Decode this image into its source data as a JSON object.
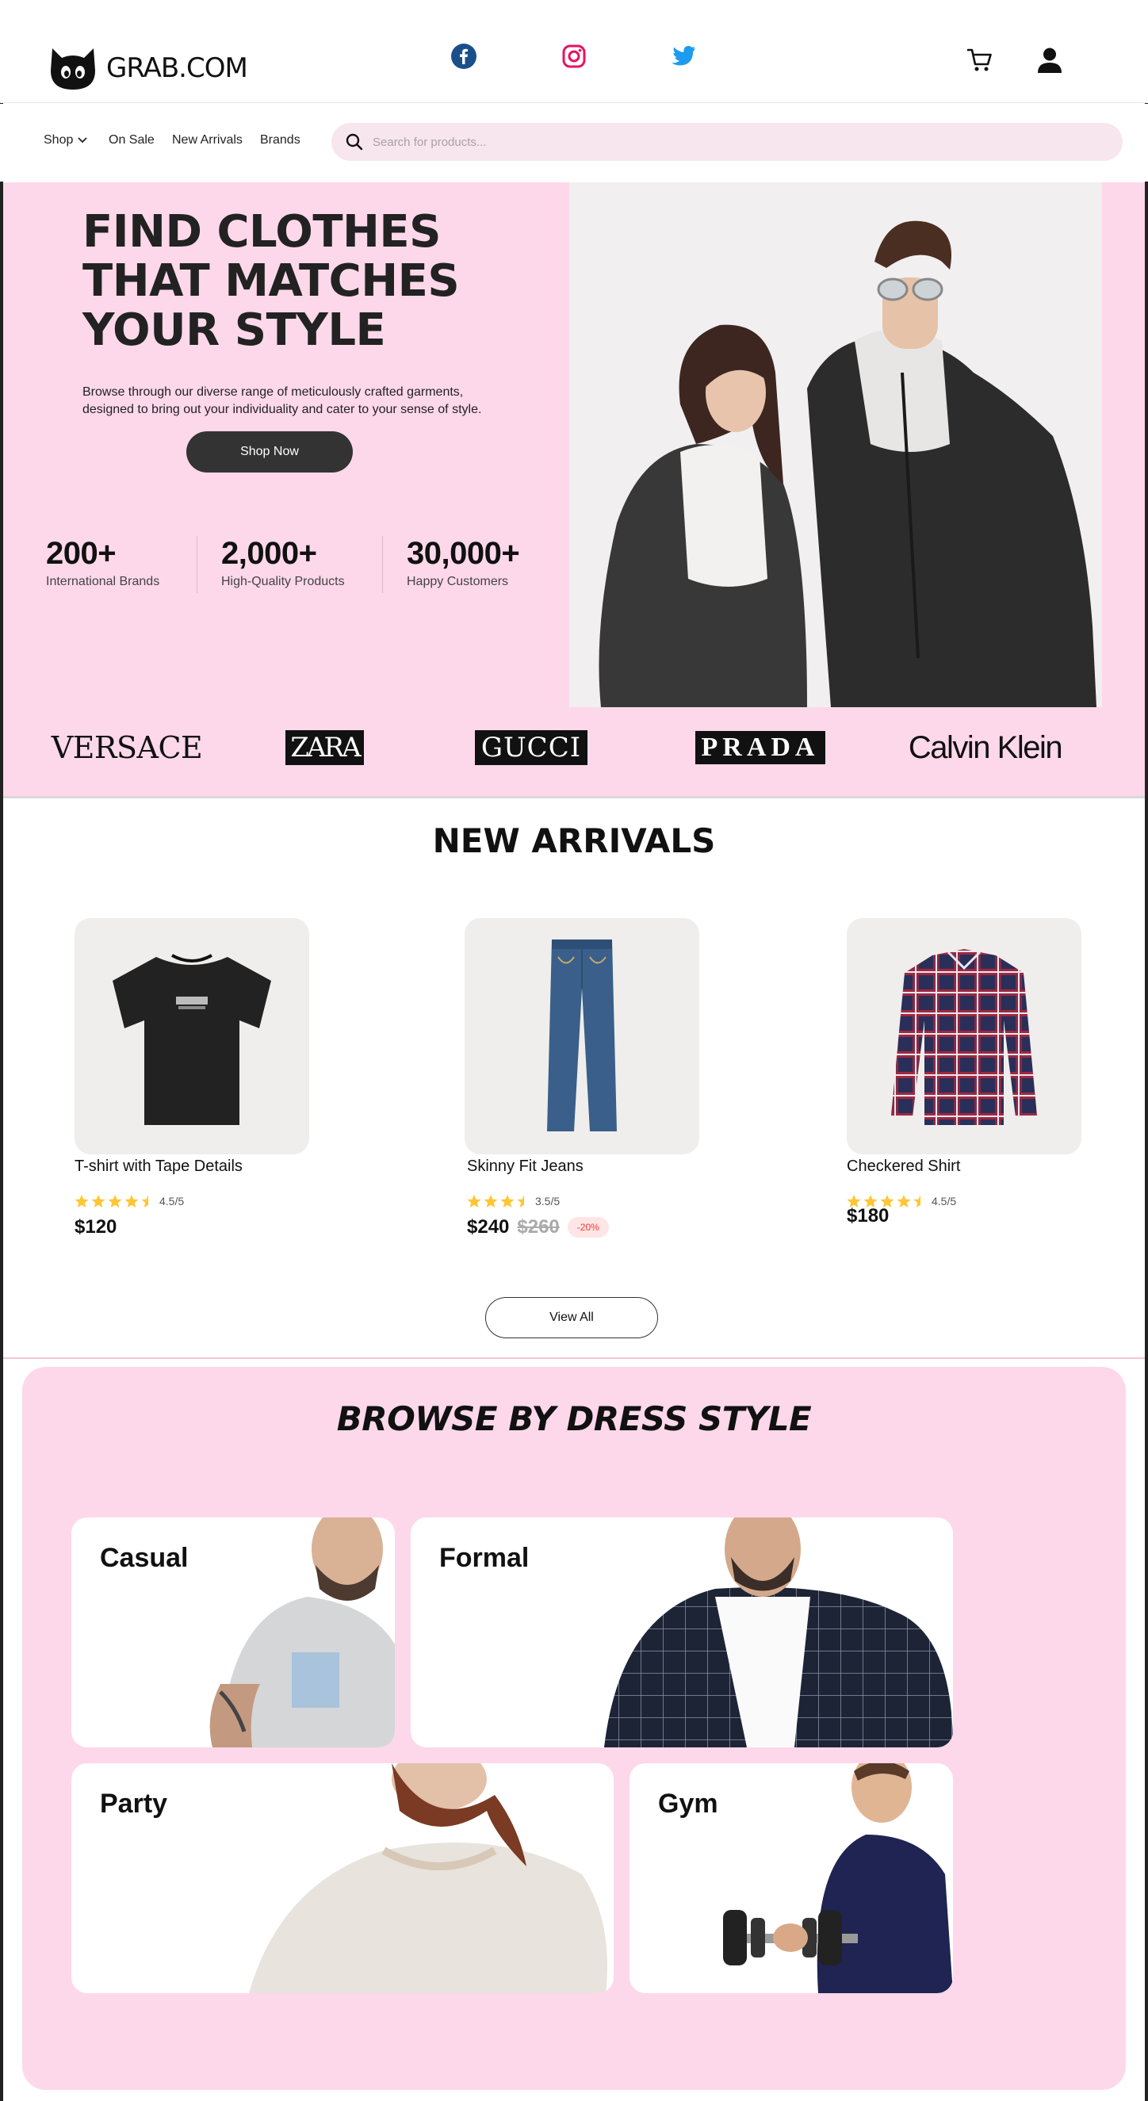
{
  "header": {
    "logo_text": "GRAB.COM",
    "social": [
      "facebook-icon",
      "instagram-icon",
      "twitter-icon"
    ],
    "colors": {
      "facebook": "#1b4f8a",
      "instagram": "#e6135f",
      "twitter": "#1d9bf0"
    }
  },
  "nav": {
    "items": [
      "Shop",
      "On Sale",
      "New Arrivals",
      "Brands"
    ],
    "search_placeholder": "Search for products..."
  },
  "hero": {
    "title": "FIND CLOTHES THAT MATCHES YOUR STYLE",
    "description": "Browse through our diverse range of meticulously crafted garments, designed to bring out your individuality and cater to your sense of style.",
    "cta": "Shop Now",
    "stats": [
      {
        "value": "200+",
        "label": "International Brands"
      },
      {
        "value": "2,000+",
        "label": "High-Quality Products"
      },
      {
        "value": "30,000+",
        "label": "Happy Customers"
      }
    ]
  },
  "brands": [
    "VERSACE",
    "ZARA",
    "GUCCI",
    "PRADA",
    "Calvin Klein"
  ],
  "new_arrivals": {
    "title": "NEW ARRIVALS",
    "products": [
      {
        "name": "T-shirt with Tape Details",
        "rating": 4.5,
        "rating_text": "4.5/5",
        "price": "$120"
      },
      {
        "name": "Skinny Fit Jeans",
        "rating": 3.5,
        "rating_text": "3.5/5",
        "price": "$240",
        "old_price": "$260",
        "discount": "-20%"
      },
      {
        "name": "Checkered Shirt",
        "rating": 4.5,
        "rating_text": "4.5/5",
        "price": "$180"
      }
    ],
    "view_all": "View All"
  },
  "browse": {
    "title": "BROWSE BY DRESS STYLE",
    "styles": [
      "Casual",
      "Formal",
      "Party",
      "Gym"
    ]
  },
  "colors": {
    "accent_pink": "#fdd8ea",
    "dark": "#333333",
    "star": "#ffc633"
  }
}
